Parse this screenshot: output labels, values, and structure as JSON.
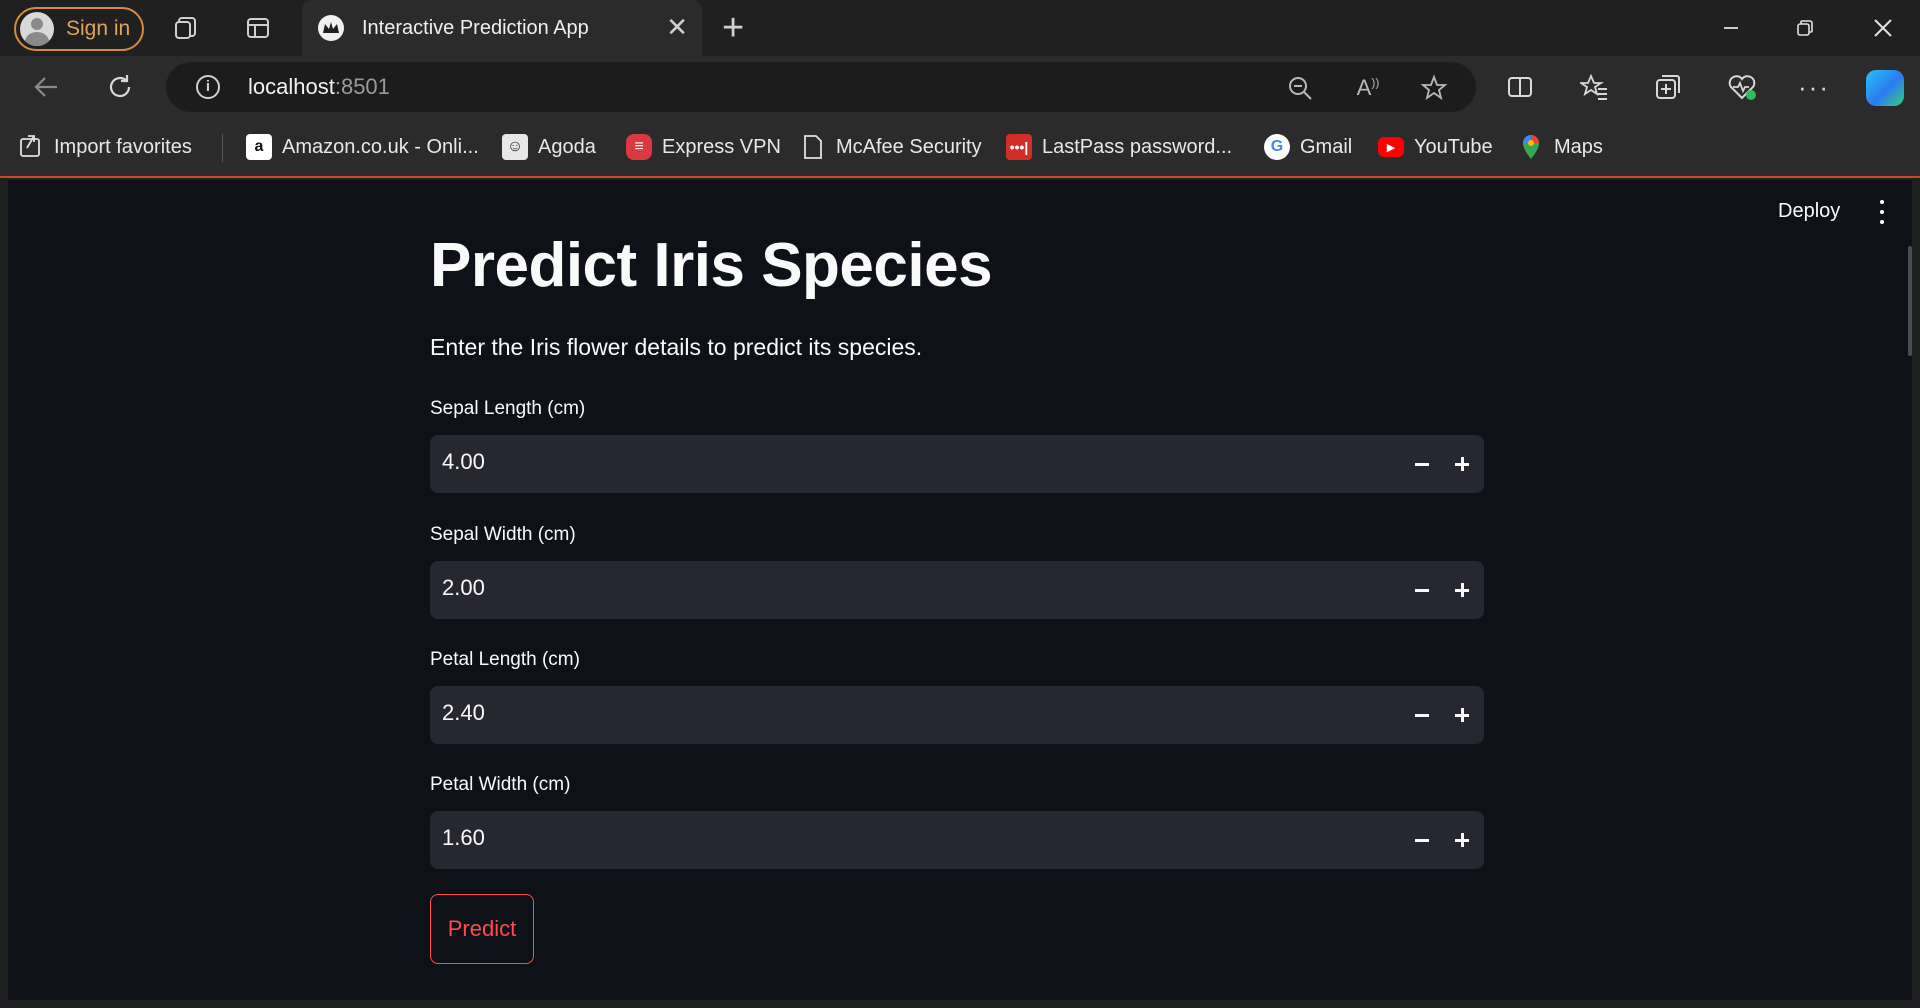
{
  "browser": {
    "signin_label": "Sign in",
    "tab_title": "Interactive Prediction App",
    "url_host": "localhost",
    "url_port": ":8501",
    "accent_color": "#d68a3c"
  },
  "bookmarks": [
    {
      "label": "Import favorites",
      "icon": "import-icon"
    },
    {
      "label": "Amazon.co.uk - Onli...",
      "icon": "amazon-icon"
    },
    {
      "label": "Agoda",
      "icon": "agoda-icon"
    },
    {
      "label": "Express VPN",
      "icon": "expressvpn-icon"
    },
    {
      "label": "McAfee Security",
      "icon": "page-icon"
    },
    {
      "label": "LastPass password...",
      "icon": "lastpass-icon"
    },
    {
      "label": "Gmail",
      "icon": "google-icon"
    },
    {
      "label": "YouTube",
      "icon": "youtube-icon"
    },
    {
      "label": "Maps",
      "icon": "maps-icon"
    }
  ],
  "app": {
    "deploy_label": "Deploy",
    "title": "Predict Iris Species",
    "subtitle": "Enter the Iris flower details to predict its species.",
    "fields": [
      {
        "label": "Sepal Length (cm)",
        "value": "4.00"
      },
      {
        "label": "Sepal Width (cm)",
        "value": "2.00"
      },
      {
        "label": "Petal Length (cm)",
        "value": "2.40"
      },
      {
        "label": "Petal Width (cm)",
        "value": "1.60"
      }
    ],
    "predict_label": "Predict",
    "primary_color": "#ff4b4b",
    "background_color": "#0e1117"
  }
}
